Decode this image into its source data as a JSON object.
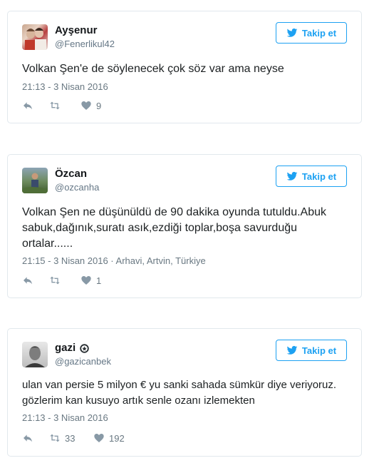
{
  "follow_label": "Takip et",
  "tweets": [
    {
      "name": "Ayşenur",
      "handle": "@Fenerlikul42",
      "verified": false,
      "text": "Volkan Şen'e de söylenecek çok söz var ama neyse",
      "meta": "21:13 - 3 Nisan 2016",
      "retweets": "",
      "likes": "9",
      "avatar": "avatar-two-women"
    },
    {
      "name": "Özcan",
      "handle": "@ozcanha",
      "verified": false,
      "text": "Volkan Şen ne düşünüldü de 90 dakika oyunda tutuldu.Abuk sabuk,dağınık,suratı asık,ezdiği toplar,boşa savurduğu ortalar......",
      "meta": "21:15 - 3 Nisan 2016 · Arhavi, Artvin, Türkiye",
      "retweets": "",
      "likes": "1",
      "avatar": "avatar-man-outdoor"
    },
    {
      "name": "gazi",
      "handle": "@gazicanbek",
      "verified": true,
      "text": "ulan van persie 5 milyon € yu sanki sahada sümkür diye veriyoruz. gözlerim kan kusuyo artık senle ozanı izlemekten",
      "meta": "21:13 - 3 Nisan 2016",
      "retweets": "33",
      "likes": "192",
      "avatar": "avatar-man-portrait"
    }
  ],
  "colors": {
    "accent": "#1da1f2",
    "muted": "#697882",
    "border": "#e1e8ed"
  },
  "icons": [
    "twitter-bird-icon",
    "reply-icon",
    "retweet-icon",
    "heart-icon",
    "verified-icon"
  ]
}
